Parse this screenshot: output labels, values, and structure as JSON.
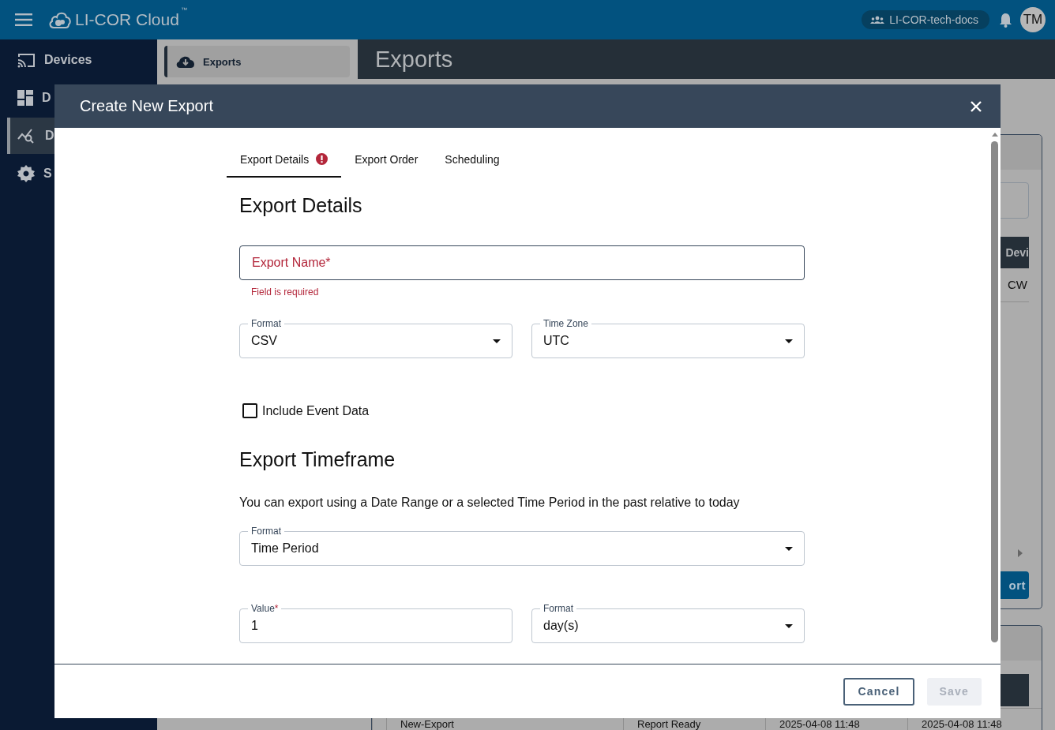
{
  "app": {
    "title": "LI-COR Cloud",
    "trademark": "™",
    "org": "LI-COR-tech-docs",
    "avatar": "TM"
  },
  "sidebar": {
    "items": [
      {
        "label": "Devices",
        "selected": false
      },
      {
        "label": "D",
        "selected": false
      },
      {
        "label": "D",
        "selected": true
      },
      {
        "label": "S",
        "selected": false
      }
    ]
  },
  "subnav": {
    "items": [
      {
        "label": "Exports",
        "selected": true
      }
    ]
  },
  "page": {
    "title": "Exports"
  },
  "background_card": {
    "column_1": "Devi",
    "cell_1": "CW",
    "button": "ort"
  },
  "background_table": {
    "rows": [
      {
        "cells": [
          "New-Export",
          "Report Ready",
          "2025-04-08 11:48",
          "2025-04-08 11:48"
        ]
      }
    ]
  },
  "dialog": {
    "title": "Create New Export",
    "tabs": [
      {
        "label": "Export Details",
        "selected": true,
        "error": true
      },
      {
        "label": "Export Order",
        "selected": false,
        "error": false
      },
      {
        "label": "Scheduling",
        "selected": false,
        "error": false
      }
    ],
    "details": {
      "heading": "Export Details",
      "name_field": {
        "placeholder": "Export Name*",
        "invalid": true,
        "error": "Field is required"
      },
      "fields": [
        {
          "kind": "select",
          "label": "Format",
          "value": "CSV"
        },
        {
          "kind": "select",
          "label": "Time Zone",
          "value": "UTC"
        }
      ],
      "checkbox": {
        "label": "Include Event Data",
        "checked": false
      }
    },
    "timeframe": {
      "heading": "Export Timeframe",
      "description": "You can export using a Date Range or a selected Time Period in the past relative to today",
      "rows": [
        [
          {
            "kind": "select",
            "label": "Format",
            "value": "Time Period"
          }
        ],
        [
          {
            "kind": "text",
            "label": "Value",
            "required_mark": "*",
            "value": "1"
          },
          {
            "kind": "select",
            "label": "Format",
            "value": "day(s)"
          }
        ]
      ]
    },
    "buttons": [
      {
        "label": "Cancel",
        "kind": "outlined",
        "disabled": false
      },
      {
        "label": "Save",
        "kind": "filled",
        "disabled": true
      }
    ]
  }
}
